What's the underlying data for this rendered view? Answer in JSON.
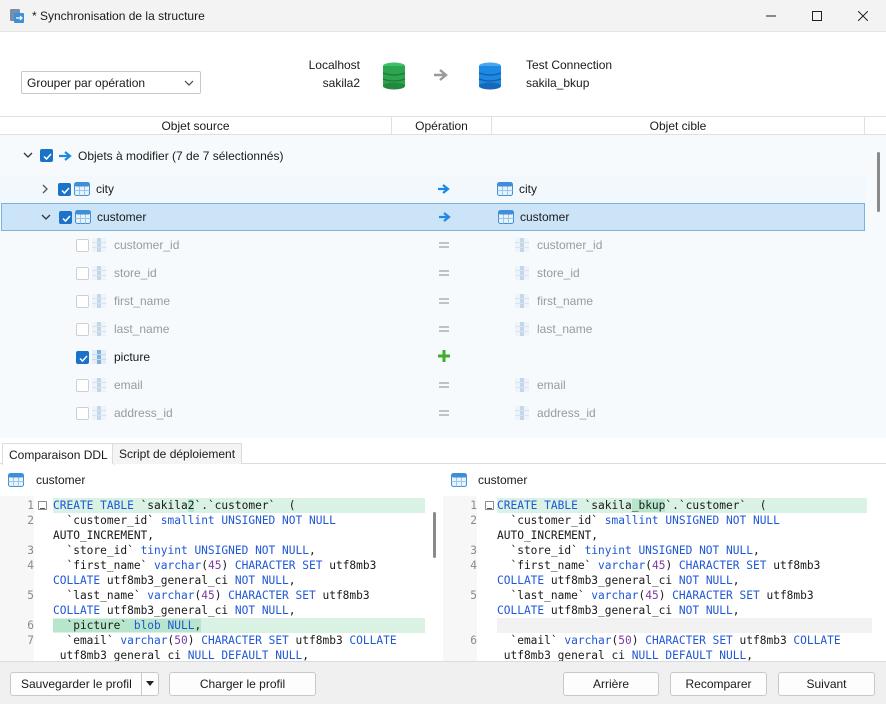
{
  "window": {
    "title": "* Synchronisation de la structure"
  },
  "header": {
    "group_select_value": "Grouper par opération",
    "source": {
      "connection": "Localhost",
      "database": "sakila2"
    },
    "target": {
      "connection": "Test Connection",
      "database": "sakila_bkup"
    }
  },
  "columns": {
    "source": "Objet source",
    "operation": "Opération",
    "target": "Objet cible"
  },
  "tree": {
    "group_label": "Objets à modifier (7 de 7 sélectionnés)",
    "rows": [
      {
        "source": "city",
        "target": "city",
        "op": "modify"
      },
      {
        "source": "customer",
        "target": "customer",
        "op": "modify"
      },
      {
        "source": "customer_id",
        "target": "customer_id",
        "op": "equal"
      },
      {
        "source": "store_id",
        "target": "store_id",
        "op": "equal"
      },
      {
        "source": "first_name",
        "target": "first_name",
        "op": "equal"
      },
      {
        "source": "last_name",
        "target": "last_name",
        "op": "equal"
      },
      {
        "source": "picture",
        "target": "",
        "op": "add"
      },
      {
        "source": "email",
        "target": "email",
        "op": "equal"
      },
      {
        "source": "address_id",
        "target": "address_id",
        "op": "equal"
      }
    ]
  },
  "tabs": {
    "ddl": "Comparaison DDL",
    "deploy": "Script de déploiement"
  },
  "ddl": {
    "left_title": "customer",
    "right_title": "customer",
    "left_numbers": [
      "1",
      "2",
      "3",
      "4",
      "5",
      "6",
      "7"
    ],
    "right_numbers": [
      "1",
      "2",
      "3",
      "4",
      "5",
      "6"
    ]
  },
  "footer": {
    "save_profile": "Sauvegarder le profil",
    "load_profile": "Charger le profil",
    "back": "Arrière",
    "recompare": "Recomparer",
    "next": "Suivant"
  },
  "colors": {
    "accent": "#1a73c8",
    "selection": "#cce4f7",
    "diff_added": "#d9f2e4",
    "db_source": "#2da44e",
    "db_target": "#1e88e5",
    "add_icon": "#3fae2a"
  }
}
